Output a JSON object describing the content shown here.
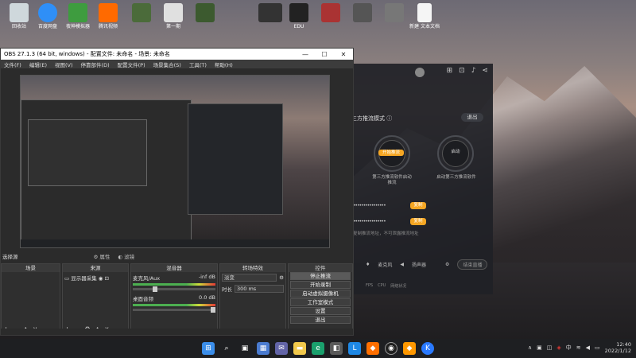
{
  "desktop": {
    "icons": [
      {
        "label": "回收站",
        "color": "#cfd8dc"
      },
      {
        "label": "百度网盘",
        "color": "#2f8ff7"
      },
      {
        "label": "夜神模拟器",
        "color": "#3e9c3f"
      },
      {
        "label": "腾讯视频",
        "color": "#ff6a00"
      },
      {
        "label": "",
        "color": "#4b6b3a"
      },
      {
        "label": "第一期",
        "color": "#e0e0e0"
      },
      {
        "label": "",
        "color": "#3c5a2f"
      },
      {
        "label": "",
        "color": "#333"
      },
      {
        "label": "EDU",
        "color": "#222"
      },
      {
        "label": "",
        "color": "#a33"
      },
      {
        "label": "",
        "color": "#555"
      },
      {
        "label": "",
        "color": "#777"
      },
      {
        "label": "新建 文本文档",
        "color": "#f5f5f5"
      }
    ]
  },
  "obs": {
    "title": "OBS 27.1.3 (64 bit, windows) - 配置文件: 未命名 - 场景: 未命名",
    "menu": [
      "文件(F)",
      "编辑(E)",
      "视图(V)",
      "停靠部件(D)",
      "配置文件(P)",
      "场景集合(S)",
      "工具(T)",
      "帮助(H)"
    ],
    "midbar": {
      "no_source": "选择源",
      "properties": "属性",
      "filters": "滤镜"
    },
    "docks": {
      "scenes": "场景",
      "sources": "来源",
      "source_item": "显示器采集",
      "mixer": "混音器",
      "mixer_rows": [
        {
          "name": "麦克风/Aux",
          "db": "-inf dB"
        },
        {
          "name": "桌面音频",
          "db": "0.0 dB"
        }
      ],
      "transitions": "转场特效",
      "transition_value": "淡变",
      "duration_label": "时长",
      "duration_value": "300 ms",
      "controls": "控件",
      "control_buttons": [
        "停止推流",
        "开始录制",
        "启动虚拟摄像机",
        "工作室模式",
        "设置",
        "退出"
      ]
    }
  },
  "app": {
    "mode_label": "三方推流模式",
    "exit_label": "退出",
    "left_circle_btn": "开始推流",
    "left_circle_cap": "第三方推流软件启动推流",
    "right_circle_btn": "启动",
    "right_circle_cap": "启动第三方推流软件",
    "key_mask_1": "••••••••••••••••",
    "key_mask_2": "••••••••••••••••",
    "copy_label": "复制",
    "hint": "复制推流地址，不可泄露推流地址",
    "bottom_items": [
      "麦克风",
      "扬声器"
    ],
    "stop_label": "结束直播",
    "status_items": [
      "FPS",
      "CPU",
      "网络状况"
    ]
  },
  "taskbar": {
    "time": "12:40",
    "date": "2022/1/12",
    "lang": "中",
    "apps": [
      {
        "name": "windows-start",
        "color": "#3b8eea"
      },
      {
        "name": "search",
        "color": "transparent"
      },
      {
        "name": "task-view",
        "color": "transparent"
      },
      {
        "name": "widgets",
        "color": "#4a7bd0"
      },
      {
        "name": "chat",
        "color": "#6264a7"
      },
      {
        "name": "file-explorer",
        "color": "#f2c94c"
      },
      {
        "name": "edge",
        "color": "#1aa06d"
      },
      {
        "name": "store",
        "color": "#5a5a5a"
      },
      {
        "name": "qq",
        "color": "#1e88e5"
      },
      {
        "name": "app-orange",
        "color": "#ff6f00"
      },
      {
        "name": "obs",
        "color": "#202020"
      },
      {
        "name": "app-orange2",
        "color": "#ff9800"
      },
      {
        "name": "app-blue",
        "color": "#2979ff"
      }
    ]
  }
}
